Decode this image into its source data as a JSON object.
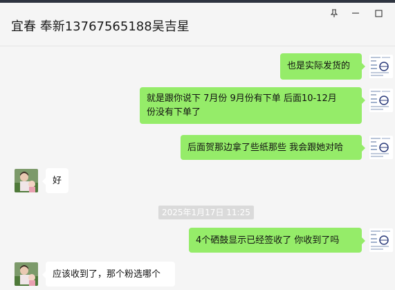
{
  "window": {
    "title": "宜春 奉新13767565188吴吉星",
    "controls": {
      "pin_icon": "pin-icon",
      "minimize_icon": "minimize-icon",
      "maximize_icon": "maximize-icon"
    }
  },
  "messages": [
    {
      "from": "me",
      "text": "也是实际发货的"
    },
    {
      "from": "me",
      "text_line1": "就是跟你说下  7月份 9月份有下单  后面10-12月",
      "text_line2": "份没有下单了"
    },
    {
      "from": "me",
      "text": "后面贺那边拿了些纸那些 我会跟她对哈"
    },
    {
      "from": "them",
      "text": "好"
    },
    {
      "type": "timestamp",
      "text": "2025年1月17日 11:25"
    },
    {
      "from": "me",
      "text": "4个硒鼓显示已经签收了   你收到了吗"
    },
    {
      "from": "them",
      "text": "应该收到了，那个粉选哪个"
    }
  ],
  "colors": {
    "my_bubble": "#95ec69",
    "their_bubble": "#ffffff",
    "background": "#f5f5f5"
  }
}
